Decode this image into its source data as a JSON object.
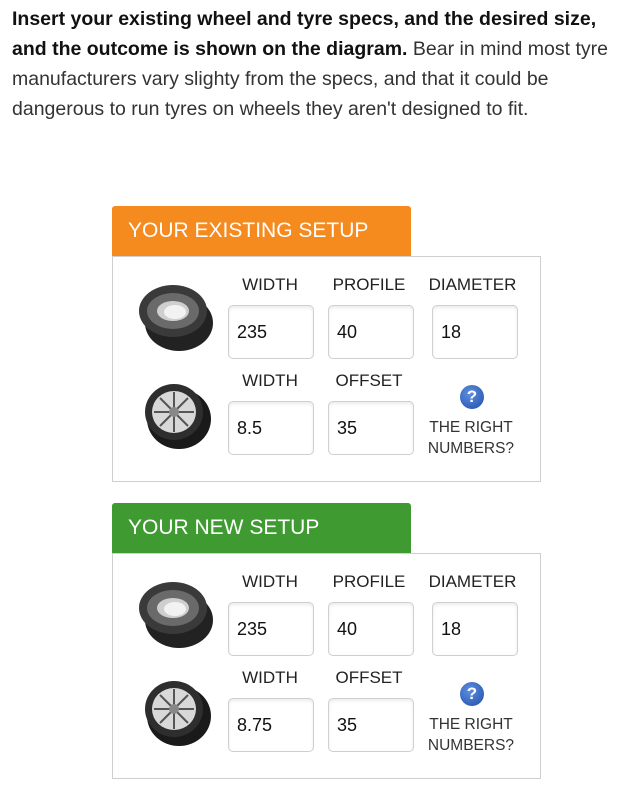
{
  "intro": {
    "bold": "Insert your existing wheel and tyre specs, and the desired size, and the outcome is shown on the diagram.",
    "normal": " Bear in mind most tyre manufacturers vary slighty from the specs, and that it could be dangerous to run tyres on wheels they aren't designed to fit."
  },
  "existing": {
    "title": "YOUR EXISTING SETUP",
    "tyre": {
      "width_label": "WIDTH",
      "profile_label": "PROFILE",
      "diameter_label": "DIAMETER",
      "width": "235",
      "profile": "40",
      "diameter": "18"
    },
    "wheel": {
      "width_label": "WIDTH",
      "offset_label": "OFFSET",
      "width": "8.5",
      "offset": "35"
    },
    "help": {
      "line1": "THE RIGHT",
      "line2": "NUMBERS?"
    }
  },
  "new": {
    "title": "YOUR NEW SETUP",
    "tyre": {
      "width_label": "WIDTH",
      "profile_label": "PROFILE",
      "diameter_label": "DIAMETER",
      "width": "235",
      "profile": "40",
      "diameter": "18"
    },
    "wheel": {
      "width_label": "WIDTH",
      "offset_label": "OFFSET",
      "width": "8.75",
      "offset": "35"
    },
    "help": {
      "line1": "THE RIGHT",
      "line2": "NUMBERS?"
    }
  },
  "icons": {
    "tyre": "tyre-icon",
    "wheel": "wheel-icon",
    "help": "question-mark-icon"
  },
  "colors": {
    "existing_tab": "#f58a1f",
    "new_tab": "#3f9a31",
    "help_icon": "#2a5cb8"
  }
}
